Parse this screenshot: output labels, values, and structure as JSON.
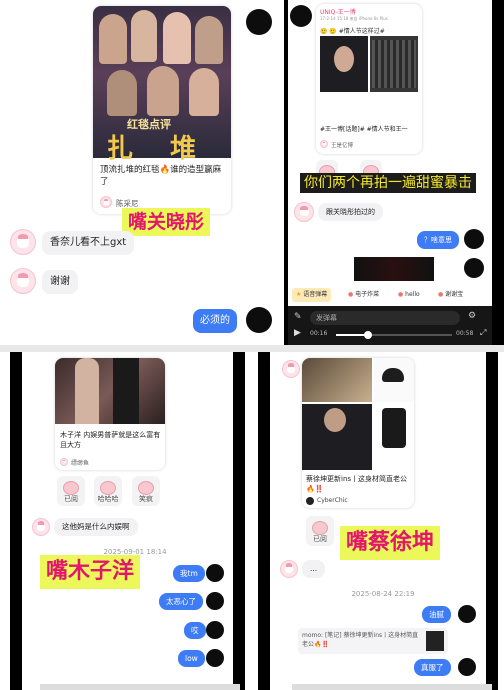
{
  "panel1": {
    "card_caption": "顶流扎堆的红毯🔥谁的造型赢麻了",
    "card_user": "陈采尼",
    "poster_title": "红毯点评",
    "poster_big": "扎 堆",
    "label": "嘴关晓彤",
    "msg1": "香奈儿看不上gxt",
    "msg2": "谢谢",
    "reply": "必须的"
  },
  "panel2": {
    "post_user": "UNIQ-王一博",
    "post_meta": "17-2-14 15:18 来自 iPhone 6s Plus",
    "post_tags": "🙂 🙂 #情人节这样过#",
    "card_tags": "#王一博[话题]# #情人节和王一",
    "card_user": "王是亿博",
    "subtitle": "你们两个再拍一遍甜蜜暴击",
    "msg": "跟关晓彤拍过的",
    "reply": "？啥意思",
    "toolbar": [
      "语音弹幕",
      "电子炸菜",
      "hello",
      "谢谢宝"
    ],
    "input_placeholder": "发弹幕",
    "time_cur": "00:16",
    "time_total": "00:58"
  },
  "panel3": {
    "card_caption": "木子洋 内娱男普萨就是这么富有且大方",
    "card_user": "缥缈鱼",
    "reacts": [
      "已阅",
      "哈哈哈",
      "笑疯"
    ],
    "msg": "这他妈是什么内娱啊",
    "timestamp": "2025-09-01 18:14",
    "label": "嘴木子洋",
    "replies": [
      "我tm",
      "太恶心了",
      "哎",
      "low"
    ]
  },
  "panel4": {
    "card_caption": "蔡徐坤更新ins丨这身材简直老公🔥‼️",
    "card_user": "CyberChic",
    "react": "已阅",
    "label": "嘴蔡徐坤",
    "msg_dots": "...",
    "timestamp": "2025-08-24 22:19",
    "reply1": "油腻",
    "quote": "momo: [笔记] 蔡徐坤更新ins丨这身材简直老公🔥‼️",
    "reply2": "真服了"
  }
}
